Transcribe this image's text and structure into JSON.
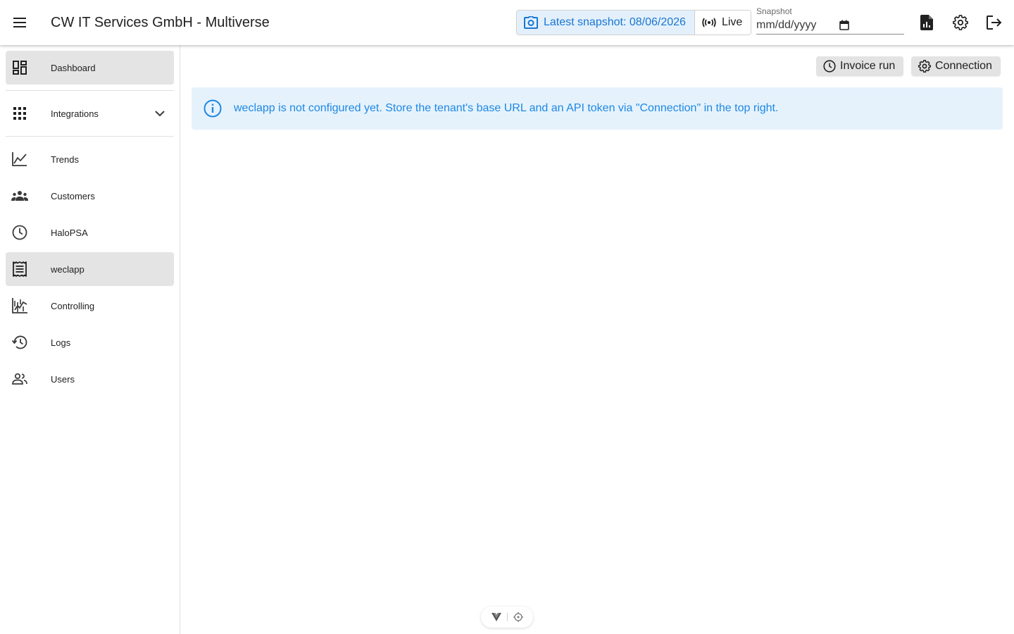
{
  "app": {
    "title": "CW IT Services GmbH - Multiverse"
  },
  "header": {
    "snapshot_button_label": "Latest snapshot: 08/06/2026",
    "live_button_label": "Live",
    "snapshot_field_label": "Snapshot",
    "snapshot_field_placeholder": "mm/dd/yyyy",
    "icons": [
      "menu-icon",
      "camera-icon",
      "live-broadcast-icon",
      "calendar-icon",
      "report-icon",
      "settings-icon",
      "logout-icon"
    ]
  },
  "sidebar": {
    "items": [
      {
        "label": "Dashboard",
        "icon": "dashboard-icon",
        "active": false
      },
      {
        "label": "Integrations",
        "icon": "apps-grid-icon",
        "expandable": true
      },
      {
        "label": "Trends",
        "icon": "line-chart-icon"
      },
      {
        "label": "Customers",
        "icon": "group-icon"
      },
      {
        "label": "HaloPSA",
        "icon": "clock-icon"
      },
      {
        "label": "weclapp",
        "icon": "receipt-icon",
        "active": true
      },
      {
        "label": "Controlling",
        "icon": "stock-chart-icon"
      },
      {
        "label": "Logs",
        "icon": "history-icon"
      },
      {
        "label": "Users",
        "icon": "people-icon"
      }
    ]
  },
  "main": {
    "toolbar": {
      "invoice_run_label": "Invoice run",
      "connection_label": "Connection"
    },
    "alert": {
      "text": "weclapp is not configured yet. Store the tenant's base URL and an API token via \"Connection\" in the top right.",
      "icon": "info-icon"
    }
  },
  "colors": {
    "primary": "#1976d2",
    "alert_bg": "#e5f2fc",
    "alert_text": "#1e88e5",
    "active_nav_bg": "#e4e4e4"
  }
}
